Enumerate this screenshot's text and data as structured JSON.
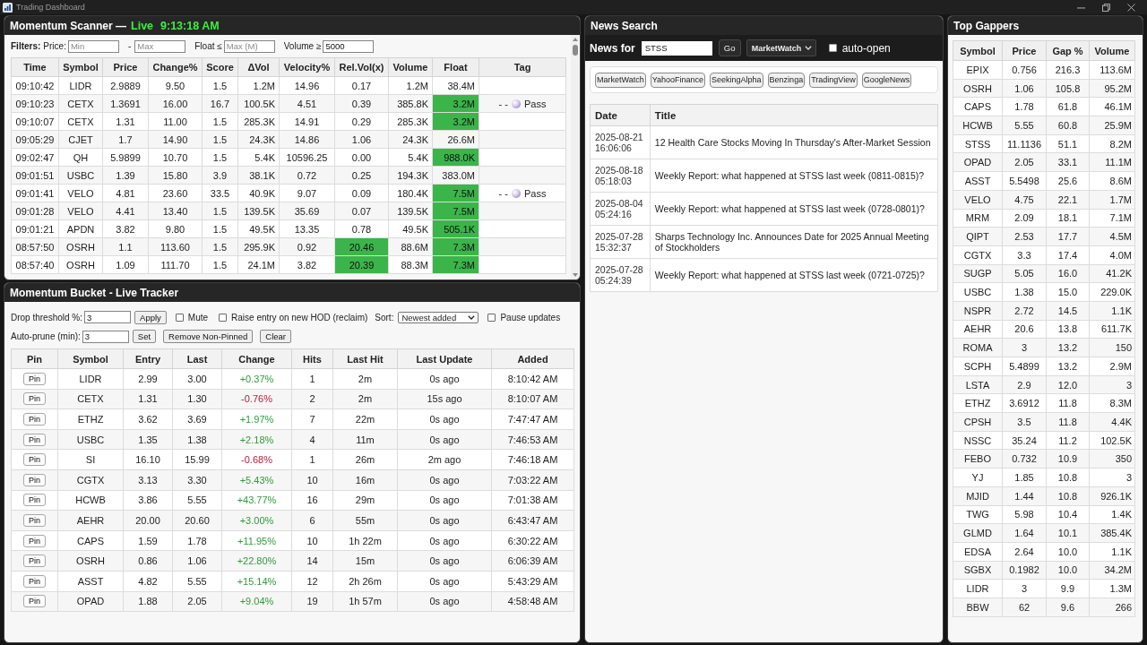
{
  "window": {
    "title": "Trading Dashboard"
  },
  "scanner": {
    "title": "Momentum Scanner —",
    "live": "Live",
    "clock": "9:13:18 AM",
    "filters": {
      "label": "Filters:",
      "price_label": "Price:",
      "min_placeholder": "Min",
      "dash": "-",
      "max_placeholder": "Max",
      "float_label": "Float ≤",
      "float_placeholder": "Max (M)",
      "volume_label": "Volume ≥",
      "volume_value": "5000"
    },
    "columns": [
      "Time",
      "Symbol",
      "Price",
      "Change%",
      "Score",
      "ΔVol",
      "Velocity%",
      "Rel.Vol(x)",
      "Volume",
      "Float",
      "Tag"
    ],
    "rows": [
      {
        "cells": [
          "09:10:42",
          "LIDR",
          "2.9889",
          "9.50",
          "1.5",
          "1.2M",
          "14.96",
          "0.17",
          "1.2M",
          "38.4M"
        ],
        "relvol_hot": false,
        "float_hot": false
      },
      {
        "cells": [
          "09:10:23",
          "CETX",
          "1.3691",
          "16.00",
          "16.7",
          "100.5K",
          "4.51",
          "0.39",
          "385.8K",
          "3.2M"
        ],
        "relvol_hot": false,
        "float_hot": true,
        "tag": {
          "dashes": "- -",
          "label": "Pass"
        }
      },
      {
        "cells": [
          "09:10:07",
          "CETX",
          "1.31",
          "11.00",
          "1.5",
          "285.3K",
          "14.91",
          "0.29",
          "285.3K",
          "3.2M"
        ],
        "relvol_hot": false,
        "float_hot": true
      },
      {
        "cells": [
          "09:05:29",
          "CJET",
          "1.7",
          "14.90",
          "1.5",
          "24.3K",
          "14.86",
          "1.06",
          "24.3K",
          "26.6M"
        ],
        "relvol_hot": false,
        "float_hot": false
      },
      {
        "cells": [
          "09:02:47",
          "QH",
          "5.9899",
          "10.70",
          "1.5",
          "5.4K",
          "10596.25",
          "0.00",
          "5.4K",
          "988.0K"
        ],
        "relvol_hot": false,
        "float_hot": true
      },
      {
        "cells": [
          "09:01:51",
          "USBC",
          "1.39",
          "15.80",
          "3.9",
          "38.1K",
          "0.72",
          "0.25",
          "194.3K",
          "383.0M"
        ],
        "relvol_hot": false,
        "float_hot": false
      },
      {
        "cells": [
          "09:01:41",
          "VELO",
          "4.81",
          "23.60",
          "33.5",
          "40.9K",
          "9.07",
          "0.09",
          "180.4K",
          "7.5M"
        ],
        "relvol_hot": false,
        "float_hot": true,
        "tag": {
          "dashes": "- -",
          "label": "Pass"
        }
      },
      {
        "cells": [
          "09:01:28",
          "VELO",
          "4.41",
          "13.40",
          "1.5",
          "139.5K",
          "35.69",
          "0.07",
          "139.5K",
          "7.5M"
        ],
        "relvol_hot": false,
        "float_hot": true
      },
      {
        "cells": [
          "09:01:21",
          "APDN",
          "3.82",
          "9.80",
          "1.5",
          "49.5K",
          "13.35",
          "0.78",
          "49.5K",
          "505.1K"
        ],
        "relvol_hot": false,
        "float_hot": true
      },
      {
        "cells": [
          "08:57:50",
          "OSRH",
          "1.1",
          "113.60",
          "1.5",
          "295.9K",
          "0.92",
          "20.46",
          "88.6M",
          "7.3M"
        ],
        "relvol_hot": true,
        "float_hot": true
      },
      {
        "cells": [
          "08:57:40",
          "OSRH",
          "1.09",
          "111.70",
          "1.5",
          "24.1M",
          "3.82",
          "20.39",
          "88.3M",
          "7.3M"
        ],
        "relvol_hot": true,
        "float_hot": true
      }
    ]
  },
  "bucket": {
    "title": "Momentum Bucket - Live Tracker",
    "controls": {
      "drop_label": "Drop threshold %:",
      "drop_value": "3",
      "apply": "Apply",
      "mute": {
        "label": "Mute",
        "checked": false
      },
      "raise_on_hod": {
        "label": "Raise entry on new HOD (reclaim)",
        "checked": false
      },
      "sort_label": "Sort:",
      "sort_value": "Newest added",
      "pause": {
        "label": "Pause updates",
        "checked": false
      },
      "prune_label": "Auto-prune (min):",
      "prune_value": "3",
      "set": "Set",
      "remove": "Remove Non-Pinned",
      "clear": "Clear"
    },
    "columns": [
      "Pin",
      "Symbol",
      "Entry",
      "Last",
      "Change",
      "Hits",
      "Last Hit",
      "Last Update",
      "Added"
    ],
    "rows": [
      {
        "pin": "Pin",
        "symbol": "LIDR",
        "entry": "2.99",
        "last": "3.00",
        "change": "+0.37%",
        "negative": false,
        "hits": "1",
        "last_hit": "2m",
        "last_update": "0s ago",
        "added": "8:10:42 AM"
      },
      {
        "pin": "Pin",
        "symbol": "CETX",
        "entry": "1.31",
        "last": "1.30",
        "change": "-0.76%",
        "negative": true,
        "hits": "2",
        "last_hit": "2m",
        "last_update": "15s ago",
        "added": "8:10:07 AM"
      },
      {
        "pin": "Pin",
        "symbol": "ETHZ",
        "entry": "3.62",
        "last": "3.69",
        "change": "+1.97%",
        "negative": false,
        "hits": "7",
        "last_hit": "22m",
        "last_update": "0s ago",
        "added": "7:47:47 AM"
      },
      {
        "pin": "Pin",
        "symbol": "USBC",
        "entry": "1.35",
        "last": "1.38",
        "change": "+2.18%",
        "negative": false,
        "hits": "4",
        "last_hit": "11m",
        "last_update": "0s ago",
        "added": "7:46:53 AM"
      },
      {
        "pin": "Pin",
        "symbol": "SI",
        "entry": "16.10",
        "last": "15.99",
        "change": "-0.68%",
        "negative": true,
        "hits": "1",
        "last_hit": "26m",
        "last_update": "2m ago",
        "added": "7:46:18 AM"
      },
      {
        "pin": "Pin",
        "symbol": "CGTX",
        "entry": "3.13",
        "last": "3.30",
        "change": "+5.43%",
        "negative": false,
        "hits": "10",
        "last_hit": "16m",
        "last_update": "0s ago",
        "added": "7:03:22 AM"
      },
      {
        "pin": "Pin",
        "symbol": "HCWB",
        "entry": "3.86",
        "last": "5.55",
        "change": "+43.77%",
        "negative": false,
        "hits": "16",
        "last_hit": "29m",
        "last_update": "0s ago",
        "added": "7:01:38 AM"
      },
      {
        "pin": "Pin",
        "symbol": "AEHR",
        "entry": "20.00",
        "last": "20.60",
        "change": "+3.00%",
        "negative": false,
        "hits": "6",
        "last_hit": "55m",
        "last_update": "0s ago",
        "added": "6:43:47 AM"
      },
      {
        "pin": "Pin",
        "symbol": "CAPS",
        "entry": "1.59",
        "last": "1.78",
        "change": "+11.95%",
        "negative": false,
        "hits": "10",
        "last_hit": "1h 22m",
        "last_update": "0s ago",
        "added": "6:30:22 AM"
      },
      {
        "pin": "Pin",
        "symbol": "OSRH",
        "entry": "0.86",
        "last": "1.06",
        "change": "+22.80%",
        "negative": false,
        "hits": "14",
        "last_hit": "15m",
        "last_update": "0s ago",
        "added": "6:06:39 AM"
      },
      {
        "pin": "Pin",
        "symbol": "ASST",
        "entry": "4.82",
        "last": "5.55",
        "change": "+15.14%",
        "negative": false,
        "hits": "12",
        "last_hit": "2h 26m",
        "last_update": "0s ago",
        "added": "5:43:29 AM"
      },
      {
        "pin": "Pin",
        "symbol": "OPAD",
        "entry": "1.88",
        "last": "2.05",
        "change": "+9.04%",
        "negative": false,
        "hits": "19",
        "last_hit": "1h 57m",
        "last_update": "0s ago",
        "added": "4:58:48 AM"
      }
    ]
  },
  "news": {
    "title": "News Search",
    "search": {
      "label": "News for",
      "value": "STSS",
      "go": "Go",
      "source": "MarketWatch",
      "auto_open": {
        "label": "auto-open",
        "checked": false
      }
    },
    "sources": [
      "MarketWatch",
      "YahooFinance",
      "SeekingAlpha",
      "Benzinga",
      "TradingView",
      "GoogleNews"
    ],
    "columns": [
      "Date",
      "Title"
    ],
    "rows": [
      {
        "date": "2025-08-21 16:06:06",
        "title": "12 Health Care Stocks Moving In Thursday's After-Market Session"
      },
      {
        "date": "2025-08-18 05:18:03",
        "title": "Weekly Report: what happened at STSS last week (0811-0815)?"
      },
      {
        "date": "2025-08-04 05:24:16",
        "title": "Weekly Report: what happened at STSS last week (0728-0801)?"
      },
      {
        "date": "2025-07-28 15:32:37",
        "title": "Sharps Technology Inc. Announces Date for 2025 Annual Meeting of Stockholders"
      },
      {
        "date": "2025-07-28 05:24:39",
        "title": "Weekly Report: what happened at STSS last week (0721-0725)?"
      }
    ]
  },
  "gappers": {
    "title": "Top Gappers",
    "columns": [
      "Symbol",
      "Price",
      "Gap %",
      "Volume"
    ],
    "rows": [
      [
        "EPIX",
        "0.756",
        "216.3",
        "113.6M"
      ],
      [
        "OSRH",
        "1.06",
        "105.8",
        "95.2M"
      ],
      [
        "CAPS",
        "1.78",
        "61.8",
        "46.1M"
      ],
      [
        "HCWB",
        "5.55",
        "60.8",
        "25.9M"
      ],
      [
        "STSS",
        "11.1136",
        "51.1",
        "8.2M"
      ],
      [
        "OPAD",
        "2.05",
        "33.1",
        "11.1M"
      ],
      [
        "ASST",
        "5.5498",
        "25.6",
        "8.6M"
      ],
      [
        "VELO",
        "4.75",
        "22.1",
        "1.7M"
      ],
      [
        "MRM",
        "2.09",
        "18.1",
        "7.1M"
      ],
      [
        "QIPT",
        "2.53",
        "17.7",
        "4.5M"
      ],
      [
        "CGTX",
        "3.3",
        "17.4",
        "4.0M"
      ],
      [
        "SUGP",
        "5.05",
        "16.0",
        "41.2K"
      ],
      [
        "USBC",
        "1.38",
        "15.0",
        "229.0K"
      ],
      [
        "NSPR",
        "2.72",
        "14.5",
        "1.1K"
      ],
      [
        "AEHR",
        "20.6",
        "13.8",
        "611.7K"
      ],
      [
        "ROMA",
        "3",
        "13.2",
        "150"
      ],
      [
        "SCPH",
        "5.4899",
        "13.2",
        "2.9M"
      ],
      [
        "LSTA",
        "2.9",
        "12.0",
        "3"
      ],
      [
        "ETHZ",
        "3.6912",
        "11.8",
        "8.3M"
      ],
      [
        "CPSH",
        "3.5",
        "11.8",
        "4.4K"
      ],
      [
        "NSSC",
        "35.24",
        "11.2",
        "102.5K"
      ],
      [
        "FEBO",
        "0.732",
        "10.9",
        "350"
      ],
      [
        "YJ",
        "1.85",
        "10.8",
        "3"
      ],
      [
        "MJID",
        "1.44",
        "10.8",
        "926.1K"
      ],
      [
        "TWG",
        "5.98",
        "10.4",
        "1.4K"
      ],
      [
        "GLMD",
        "1.64",
        "10.1",
        "385.4K"
      ],
      [
        "EDSA",
        "2.64",
        "10.0",
        "1.1K"
      ],
      [
        "SGBX",
        "0.1982",
        "10.0",
        "34.2M"
      ],
      [
        "LIDR",
        "3",
        "9.9",
        "1.3M"
      ],
      [
        "BBW",
        "62",
        "9.6",
        "266"
      ]
    ]
  }
}
